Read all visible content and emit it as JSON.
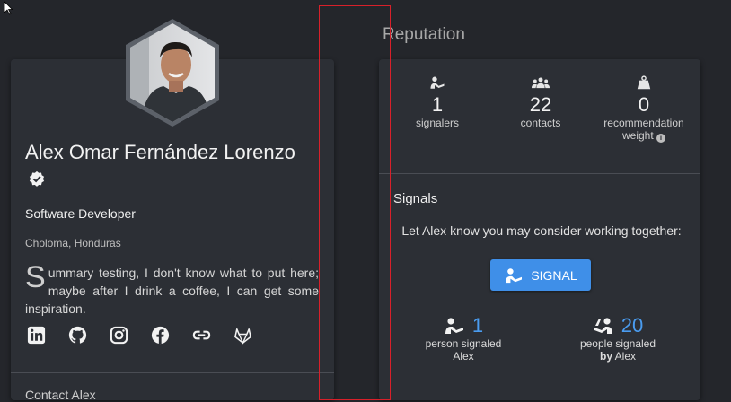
{
  "profile": {
    "name": "Alex Omar Fernández Lorenzo",
    "title": "Software Developer",
    "location": "Choloma, Honduras",
    "summary_dropcap": "S",
    "summary_rest": "ummary testing, I don't know what to put here; maybe after I drink a coffee, I can get some inspiration.",
    "social_icons": [
      "linkedin-icon",
      "github-icon",
      "instagram-icon",
      "facebook-icon",
      "link-icon",
      "gitlab-icon"
    ],
    "next_section_partial": "Contact Alex"
  },
  "reputation": {
    "heading": "Reputation",
    "stats": {
      "signalers": {
        "value": "1",
        "label": "signalers"
      },
      "contacts": {
        "value": "22",
        "label": "contacts"
      },
      "weight": {
        "value": "0",
        "label_line1": "recommendation",
        "label_line2": "weight",
        "info": "i"
      }
    },
    "signals": {
      "title": "Signals",
      "prompt": "Let Alex know you may consider working together:",
      "button_label": "SIGNAL",
      "person_signaled": {
        "value": "1",
        "line1": "person signaled",
        "line2": "Alex"
      },
      "people_signaled_by": {
        "value": "20",
        "line1": "people signaled",
        "line2_prefix": "by",
        "line2_name": "Alex"
      }
    }
  },
  "colors": {
    "accent": "#3f8fe8",
    "number_blue": "#4a9cf0",
    "overlay": "#d8202a",
    "background": "#24262b",
    "card": "#2c2f35"
  }
}
